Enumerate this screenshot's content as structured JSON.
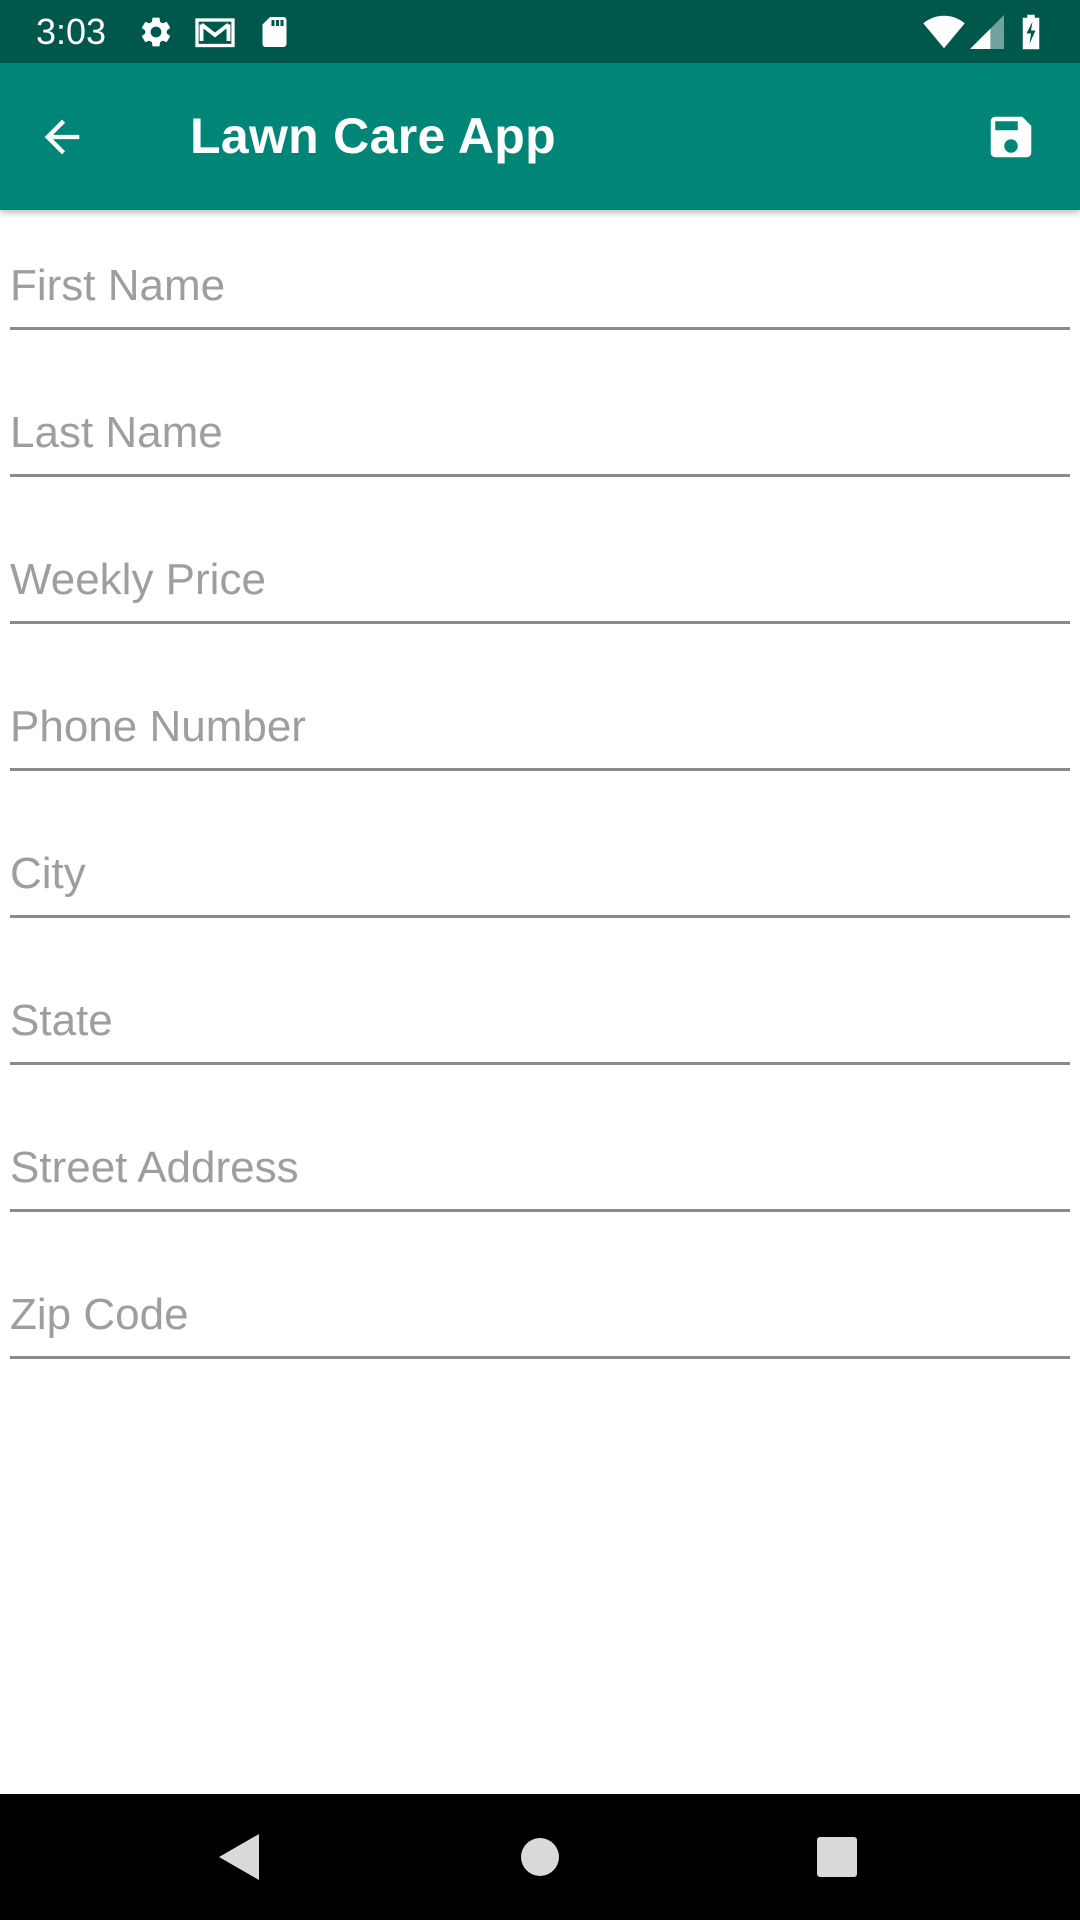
{
  "status_bar": {
    "time": "3:03",
    "icons": [
      "settings-icon",
      "gmail-icon",
      "sd-card-icon",
      "wifi-icon",
      "cell-signal-icon",
      "battery-charging-icon"
    ]
  },
  "app_bar": {
    "title": "Lawn Care App",
    "back_icon": "arrow-back-icon",
    "save_icon": "save-icon"
  },
  "form": {
    "fields": [
      {
        "name": "first-name-field",
        "placeholder": "First Name",
        "value": ""
      },
      {
        "name": "last-name-field",
        "placeholder": "Last Name",
        "value": ""
      },
      {
        "name": "weekly-price-field",
        "placeholder": "Weekly Price",
        "value": ""
      },
      {
        "name": "phone-number-field",
        "placeholder": "Phone Number",
        "value": ""
      },
      {
        "name": "city-field",
        "placeholder": "City",
        "value": ""
      },
      {
        "name": "state-field",
        "placeholder": "State",
        "value": ""
      },
      {
        "name": "street-address-field",
        "placeholder": "Street Address",
        "value": ""
      },
      {
        "name": "zip-code-field",
        "placeholder": "Zip Code",
        "value": ""
      }
    ]
  },
  "nav_bar": {
    "icons": [
      "nav-back-icon",
      "nav-home-icon",
      "nav-recents-icon"
    ]
  },
  "colors": {
    "status_bar": "#00574b",
    "app_bar": "#008577",
    "placeholder": "#9e9e9e",
    "underline": "#8a8a8a",
    "nav_bar": "#000000"
  }
}
